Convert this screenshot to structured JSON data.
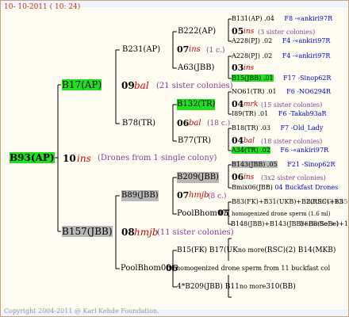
{
  "header": "10- 10-2011 ( 10: 24)",
  "footer": "Copyright 2004-2011 @ Karl Kehde Foundation.",
  "root": {
    "label": "B93(AP)",
    "num": "10",
    "mark": "ins",
    "desc": "(Drones from 1 single colony)"
  },
  "dam": {
    "label": "B17(AP)",
    "num": "09",
    "mark": "bal",
    "desc": "(21 sister colonies)",
    "mother": {
      "label": "B231(AP)",
      "num": "07",
      "mark": "ins",
      "desc": "(1 c.)",
      "mother": {
        "label": "B222(AP)",
        "num": "05",
        "mark": "ins",
        "desc": "(3 sister colonies)",
        "mother": {
          "label": "B131(AP)",
          "val": ".04",
          "line": "F8 -«ankiri97R"
        },
        "father": {
          "label": "A228(PJ)",
          "val": ".02",
          "line": "F4 -«ankiri97R"
        }
      },
      "father": {
        "label": "A63(JBB)",
        "num": "03",
        "mark": "ins",
        "mother": {
          "label": "A228(PJ)",
          "val": ".02",
          "line": "F4 -«ankiri97R"
        },
        "father": {
          "label": "B15(JBB)",
          "val": ".01",
          "line": "F17 -Sinop62R"
        }
      }
    },
    "father": {
      "label": "B78(TR)",
      "num": "06",
      "mark": "bal",
      "desc": "(18 c.)",
      "mother": {
        "label": "B132(TR)",
        "num": "04",
        "mark": "mrk",
        "desc": "(15 sister colonies)",
        "mother": {
          "label": "NO61(TR)",
          "val": ".01",
          "line": "F6 -NO6294R"
        },
        "father": {
          "label": "I89(TR)",
          "val": ".01",
          "line": "F6 -Takab93aR"
        }
      },
      "father": {
        "label": "B77(TR)",
        "num": "04",
        "mark": "bal",
        "desc": "(18 sister colonies)",
        "mother": {
          "label": "B18(TR)",
          "val": ".03",
          "line": "F7 -Old_Lady"
        },
        "father": {
          "label": "A34(TR)",
          "val": ".02",
          "line": "F6 -«ankiri97R"
        }
      }
    }
  },
  "sire": {
    "label": "B157(JBB)",
    "num": "08",
    "mark": "hmjb",
    "desc": "(11 sister colonies)",
    "mother": {
      "label": "B89(JBB)",
      "num": "07",
      "mark": "hmjb",
      "desc": "(8 c.)",
      "mother": {
        "label": "B209(JBB)",
        "num": "06",
        "mark": "ins",
        "desc": "(3x2 sister colonies)",
        "mother": {
          "label": "B143(JBB)",
          "val": ".05",
          "line": "F21 -Sinop62R"
        },
        "father": {
          "label": "Bmix06(JBB)",
          "note": "04 Buckfast Drones"
        }
      },
      "father": {
        "label": "PoolBhom07(",
        "num": "05",
        "desc": "homogenized drone sperm (1.6 ml)",
        "mother": {
          "text": "B83(FK)+B31(UKB)+B2(RSC)+B3",
          "overlap": "B2(RSC)+B5"
        },
        "father": {
          "text": "B148(JBB)+B143(JBB)+B8(SeBe)+1",
          "overlap": "B8(SeBe)+1"
        }
      }
    },
    "father": {
      "label": "PoolBhom08(",
      "num": "06",
      "desc": "homogenized drone sperm from 11 buckfast col",
      "mother": {
        "text": "B15(FK) B17(UK",
        "nomore": "no more",
        "tail": "(RSC)(2) B14(MKB)"
      },
      "father": {
        "text": "4*B209(JBB) B11",
        "nomore": "no more",
        "tail": "310(BB)"
      }
    }
  }
}
